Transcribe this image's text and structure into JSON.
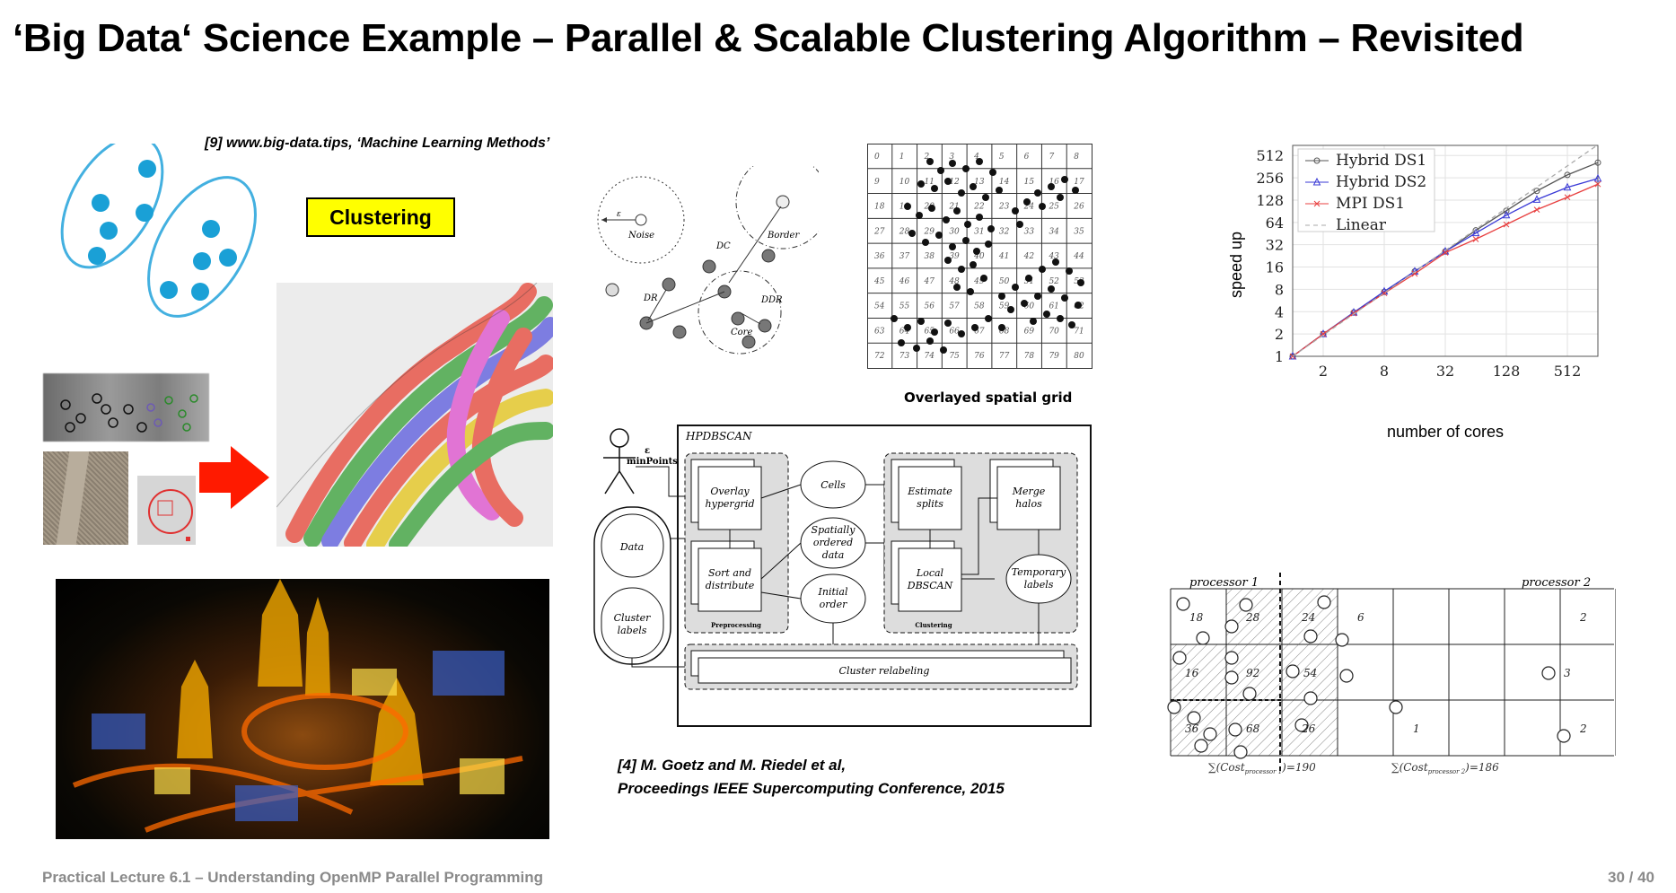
{
  "slide": {
    "title": "‘Big Data‘ Science Example – Parallel & Scalable Clustering Algorithm – Revisited",
    "footer_left": "Practical Lecture 6.1 – Understanding OpenMP Parallel Programming",
    "page_number": "30 / 40"
  },
  "references": {
    "ref9": "[9] www.big-data.tips, ‘Machine Learning Methods’",
    "ref4_line1": "[4] M. Goetz and M. Riedel et al,",
    "ref4_line2": "Proceedings IEEE Supercomputing Conference, 2015"
  },
  "clustering_label": "Clustering",
  "dbscan_diagram": {
    "eps": "ε",
    "noise": "Noise",
    "border": "Border",
    "core": "Core",
    "dc": "DC",
    "dr": "DR",
    "ddr": "DDR"
  },
  "spatial_grid": {
    "caption": "Overlayed spatial grid",
    "cells": [
      "0",
      "1",
      "2",
      "3",
      "4",
      "5",
      "6",
      "7",
      "8",
      "9",
      "10",
      "11",
      "12",
      "13",
      "14",
      "15",
      "16",
      "17",
      "18",
      "19",
      "20",
      "21",
      "22",
      "23",
      "24",
      "25",
      "26",
      "27",
      "28",
      "29",
      "30",
      "31",
      "32",
      "33",
      "34",
      "35",
      "36",
      "37",
      "38",
      "39",
      "40",
      "41",
      "42",
      "43",
      "44",
      "45",
      "46",
      "47",
      "48",
      "49",
      "50",
      "51",
      "52",
      "53",
      "54",
      "55",
      "56",
      "57",
      "58",
      "59",
      "60",
      "61",
      "62",
      "63",
      "64",
      "65",
      "66",
      "67",
      "68",
      "69",
      "70",
      "71",
      "72",
      "73",
      "74",
      "75",
      "76",
      "77",
      "78",
      "79",
      "80"
    ]
  },
  "hpdbscan": {
    "title": "HPDBSCAN",
    "eps": "ε",
    "minpoints": "minPoints",
    "data": "Data",
    "cluster_labels": "Cluster labels",
    "overlay_hypergrid": "Overlay hypergrid",
    "sort_distribute": "Sort and distribute",
    "cells": "Cells",
    "spatially_ordered": "Spatially ordered data",
    "initial_order": "Initial order",
    "estimate_splits": "Estimate splits",
    "local_dbscan": "Local DBSCAN",
    "merge_halos": "Merge halos",
    "temporary_labels": "Temporary labels",
    "preprocessing": "Preprocessing",
    "clustering": "Clustering",
    "cluster_relabeling": "Cluster relabeling"
  },
  "processor_grid": {
    "processor1": "processor 1",
    "processor2": "processor 2",
    "cost1": "∑(Cost",
    "cost1_sub": "processor 1",
    "cost1_val": ")=190",
    "cost2": "∑(Cost",
    "cost2_sub": "processor 2",
    "cost2_val": ")=186",
    "numbers": [
      "18",
      "28",
      "24",
      "6",
      "2",
      "16",
      "92",
      "54",
      "3",
      "36",
      "68",
      "26",
      "1",
      "2"
    ]
  },
  "chart_data": {
    "type": "line",
    "xlabel": "number of cores",
    "ylabel": "speed up",
    "x_scale": "log2",
    "y_scale": "log2",
    "x_ticks": [
      "2",
      "8",
      "32",
      "128",
      "512"
    ],
    "y_ticks": [
      "1",
      "2",
      "4",
      "8",
      "16",
      "32",
      "64",
      "128",
      "256",
      "512"
    ],
    "xlim": [
      1,
      1024
    ],
    "ylim": [
      1,
      700
    ],
    "legend_position": "top-left",
    "grid": true,
    "series": [
      {
        "name": "Hybrid DS1",
        "color": "#555555",
        "marker": "circle",
        "x": [
          1,
          2,
          4,
          8,
          16,
          32,
          64,
          128,
          256,
          512,
          1024
        ],
        "y": [
          1,
          2,
          3.9,
          7.4,
          14,
          26,
          50,
          92,
          170,
          280,
          410
        ]
      },
      {
        "name": "Hybrid DS2",
        "color": "#3a3ad6",
        "marker": "triangle",
        "x": [
          1,
          2,
          4,
          8,
          16,
          32,
          64,
          128,
          256,
          512,
          1024
        ],
        "y": [
          1,
          2,
          3.9,
          7.5,
          14,
          26,
          46,
          80,
          130,
          190,
          250
        ]
      },
      {
        "name": "MPI DS1",
        "color": "#e84040",
        "marker": "x",
        "x": [
          1,
          2,
          4,
          8,
          16,
          32,
          64,
          128,
          256,
          512,
          1024
        ],
        "y": [
          1,
          2,
          3.8,
          7.1,
          13,
          25,
          38,
          60,
          95,
          140,
          210
        ]
      },
      {
        "name": "Linear",
        "color": "#aaaaaa",
        "marker": "none",
        "dashed": true,
        "x": [
          1,
          1024
        ],
        "y": [
          1,
          1024
        ]
      }
    ]
  }
}
